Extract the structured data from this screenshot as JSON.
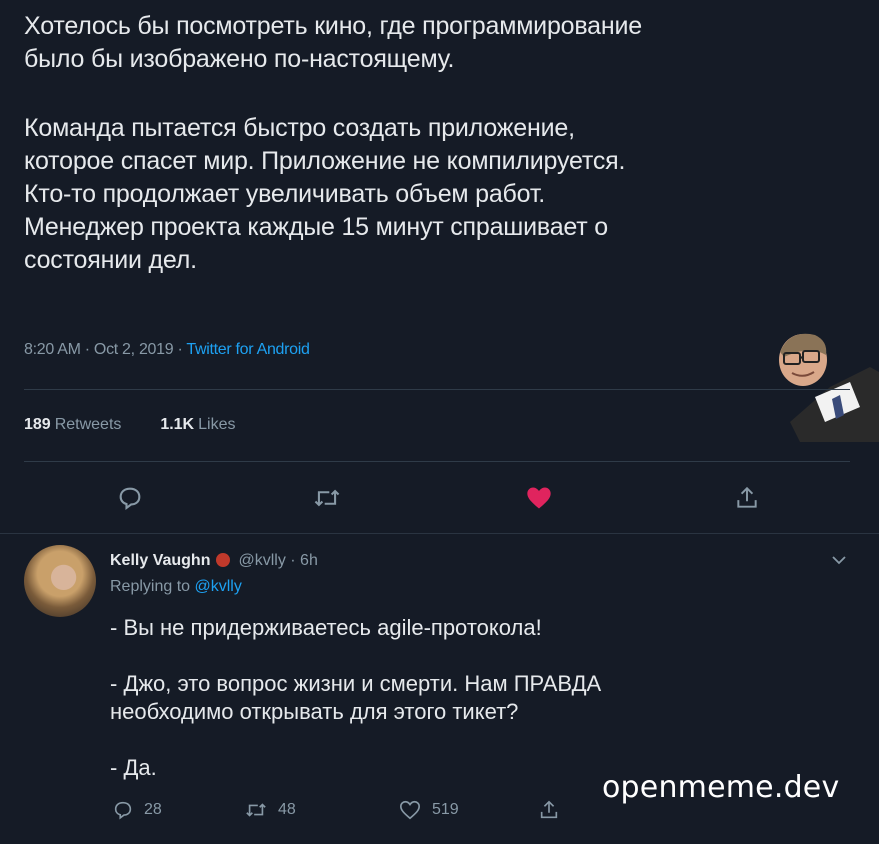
{
  "tweet": {
    "lines_p1": [
      "Хотелось бы посмотреть кино, где программирование",
      "было бы изображено по-настоящему."
    ],
    "lines_p2": [
      "Команда пытается быстро создать приложение,",
      "которое спасет мир. Приложение не компилируется.",
      "Кто-то продолжает увеличивать объем работ.",
      "Менеджер проекта каждые 15 минут спрашивает о",
      "состоянии дел."
    ],
    "meta_time": "8:20 AM · Oct 2, 2019 · ",
    "meta_source": "Twitter for Android",
    "retweets_count": "189",
    "retweets_label": "Retweets",
    "likes_count": "1.1K",
    "likes_label": "Likes"
  },
  "actions": {
    "reply_icon": "reply-icon",
    "retweet_icon": "retweet-icon",
    "like_icon": "heart-icon",
    "like_color": "#e0245e",
    "share_icon": "share-icon"
  },
  "reply": {
    "name": "Kelly Vaughn",
    "handle_time": "@kvlly · 6h",
    "replying_prefix": "Replying to ",
    "replying_handle": "@kvlly",
    "lines": [
      "- Вы не придерживаетесь agile-протокола!",
      "- Джо, это вопрос жизни и смерти. Нам ПРАВДА",
      "необходимо открывать для этого тикет?",
      "- Да."
    ],
    "reply_count": "28",
    "retweet_count": "48",
    "like_count": "519"
  },
  "watermark": "openmeme.dev",
  "colors": {
    "background": "#151b26",
    "accent": "#1da1f2",
    "muted": "#8899a6"
  }
}
